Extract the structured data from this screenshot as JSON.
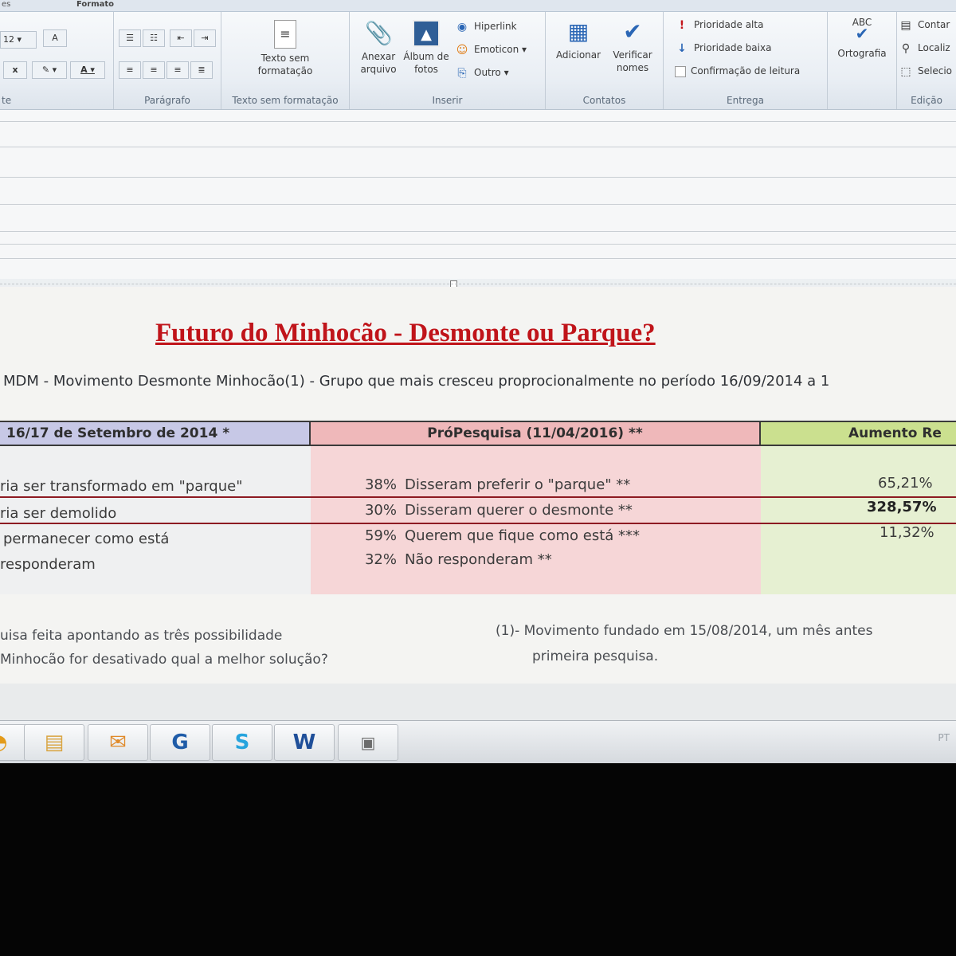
{
  "ribbon": {
    "tabs": {
      "left_partial": "es",
      "formato": "Formato"
    },
    "font_group": {
      "size": "12",
      "label": "te",
      "bold": "x",
      "font_color": "A"
    },
    "paragraph_group": {
      "label": "Parágrafo"
    },
    "plaintext_group": {
      "button": "Texto sem formatação",
      "label": "Texto sem formatação"
    },
    "insert_group": {
      "label": "Inserir",
      "attach": "Anexar arquivo",
      "album": "Álbum de fotos",
      "hyperlink": "Hiperlink",
      "emoticon": "Emoticon",
      "other": "Outro"
    },
    "contacts_group": {
      "label": "Contatos",
      "add": "Adicionar",
      "verify": "Verificar nomes"
    },
    "delivery_group": {
      "label": "Entrega",
      "high": "Prioridade alta",
      "low": "Prioridade baixa",
      "read_receipt": "Confirmação de leitura"
    },
    "spelling_group": {
      "abc": "ABC",
      "label": "Ortografia"
    },
    "edit_group": {
      "label": "Edição",
      "count": "Contar",
      "find": "Localiz",
      "select": "Selecio"
    }
  },
  "document": {
    "title": "Futuro do Minhocão - Desmonte ou Parque?",
    "subtitle": "MDM - Movimento Desmonte Minhocão(1) - Grupo que mais cresceu proprocionalmente no período 16/09/2014 a 1",
    "table": {
      "headers": [
        "16/17 de Setembro de 2014 *",
        "PróPesquisa (11/04/2016) **",
        "Aumento Re"
      ],
      "col_a": [
        "ria ser transformado em \"parque\"",
        "ria ser demolido",
        "permanecer como está",
        "responderam"
      ],
      "col_b": [
        {
          "pct": "38%",
          "text": "Disseram preferir o \"parque\" **"
        },
        {
          "pct": "30%",
          "text": "Disseram querer o desmonte **"
        },
        {
          "pct": "59%",
          "text": "Querem que fique como está ***"
        },
        {
          "pct": "32%",
          "text": "Não responderam **"
        }
      ],
      "col_c": [
        "65,21%",
        "328,57%",
        "11,32%"
      ]
    },
    "notes": {
      "left_1": "uisa feita apontando as três possibilidade",
      "left_2": "Minhocão for desativado qual a melhor solução?",
      "right_1": "(1)- Movimento fundado em 15/08/2014, um mês antes",
      "right_2": "primeira pesquisa."
    }
  },
  "taskbar": {
    "word_label": "W",
    "tray": "PT"
  },
  "colors": {
    "title_red": "#c0141a",
    "col_b_bg": "#f6d6d7",
    "col_c_bg": "#e6f0d2",
    "row_line": "#8d1a22"
  }
}
